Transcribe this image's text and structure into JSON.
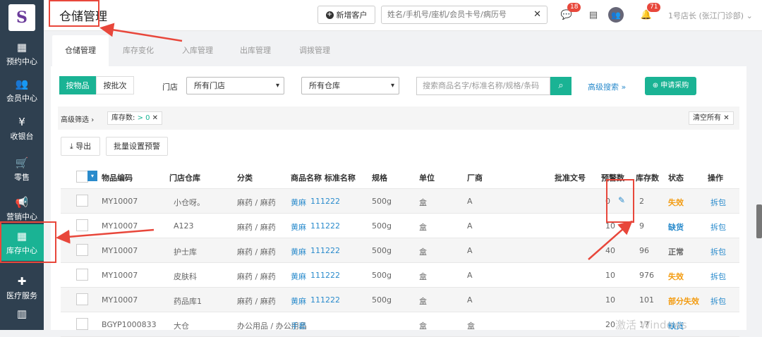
{
  "sidebar": {
    "logo_text": "S",
    "items": [
      {
        "label": "预约中心",
        "icon": "calendar-icon",
        "glyph": "▦"
      },
      {
        "label": "会员中心",
        "icon": "users-icon",
        "glyph": "👥"
      },
      {
        "label": "收银台",
        "icon": "yen-icon",
        "glyph": "¥"
      },
      {
        "label": "零售",
        "icon": "cart-icon",
        "glyph": "🛒"
      },
      {
        "label": "营销中心",
        "icon": "megaphone-icon",
        "glyph": "📢"
      },
      {
        "label": "库存中心",
        "icon": "grid-icon",
        "glyph": "▦"
      },
      {
        "label": "医疗服务",
        "icon": "medkit-icon",
        "glyph": "✚"
      },
      {
        "label": "",
        "icon": "building-icon",
        "glyph": "▥"
      }
    ]
  },
  "header": {
    "title": "仓储管理",
    "add_customer": "新增客户",
    "search_placeholder": "姓名/手机号/座机/会员卡号/病历号",
    "wechat_badge": "18",
    "bell_badge": "71",
    "user": "1号店长 (张江门诊部)"
  },
  "tabs": [
    "仓储管理",
    "库存变化",
    "入库管理",
    "出库管理",
    "调拨管理"
  ],
  "filters": {
    "by_item": "按物品",
    "by_batch": "按批次",
    "store_label": "门店",
    "store_value": "所有门店",
    "warehouse_value": "所有仓库",
    "search_placeholder": "搜索商品名字/标准名称/规格/条码",
    "advanced": "高级搜索",
    "apply": "申请采购",
    "adv_filter": "高级筛选",
    "chip_text": "库存数: ",
    "chip_value": "> 0",
    "clear_all": "清空所有"
  },
  "actions": {
    "export": "导出",
    "batch_warn": "批量设置预警"
  },
  "table": {
    "headers": [
      "物品编码",
      "门店仓库",
      "分类",
      "商品名称 标准名称",
      "规格",
      "单位",
      "厂商",
      "批准文号",
      "预警数",
      "库存数",
      "状态",
      "操作"
    ],
    "rows": [
      {
        "code": "MY10007",
        "store": "小仓呀。",
        "cat": "麻药 / 麻药",
        "name": "黄麻",
        "std": "111222",
        "spec": "500g",
        "unit": "盒",
        "maker": "A",
        "warn": "0",
        "stock": "2",
        "status": "失效",
        "status_color": "orange",
        "op": "拆包"
      },
      {
        "code": "MY10007",
        "store": "A123",
        "cat": "麻药 / 麻药",
        "name": "黄麻",
        "std": "111222",
        "spec": "500g",
        "unit": "盒",
        "maker": "A",
        "warn": "10",
        "stock": "9",
        "status": "缺货",
        "status_color": "blue",
        "op": "拆包"
      },
      {
        "code": "MY10007",
        "store": "护士库",
        "cat": "麻药 / 麻药",
        "name": "黄麻",
        "std": "111222",
        "spec": "500g",
        "unit": "盒",
        "maker": "A",
        "warn": "40",
        "stock": "96",
        "status": "正常",
        "status_color": "gray",
        "op": "拆包"
      },
      {
        "code": "MY10007",
        "store": "皮肤科",
        "cat": "麻药 / 麻药",
        "name": "黄麻",
        "std": "111222",
        "spec": "500g",
        "unit": "盒",
        "maker": "A",
        "warn": "10",
        "stock": "976",
        "status": "失效",
        "status_color": "orange",
        "op": "拆包"
      },
      {
        "code": "MY10007",
        "store": "药品库1",
        "cat": "麻药 / 麻药",
        "name": "黄麻",
        "std": "111222",
        "spec": "500g",
        "unit": "盒",
        "maker": "A",
        "warn": "10",
        "stock": "101",
        "status": "部分失效",
        "status_color": "orange",
        "op": "拆包"
      },
      {
        "code": "BGYP1000833",
        "store": "大仓",
        "cat": "办公用品 / 办公用品",
        "name": "手套",
        "std": "",
        "spec": "",
        "unit": "盒",
        "maker": "盒",
        "warn": "20",
        "stock": "17",
        "status": "缺货",
        "status_color": "blue",
        "op": ""
      }
    ]
  },
  "watermark": "激活 Windows"
}
